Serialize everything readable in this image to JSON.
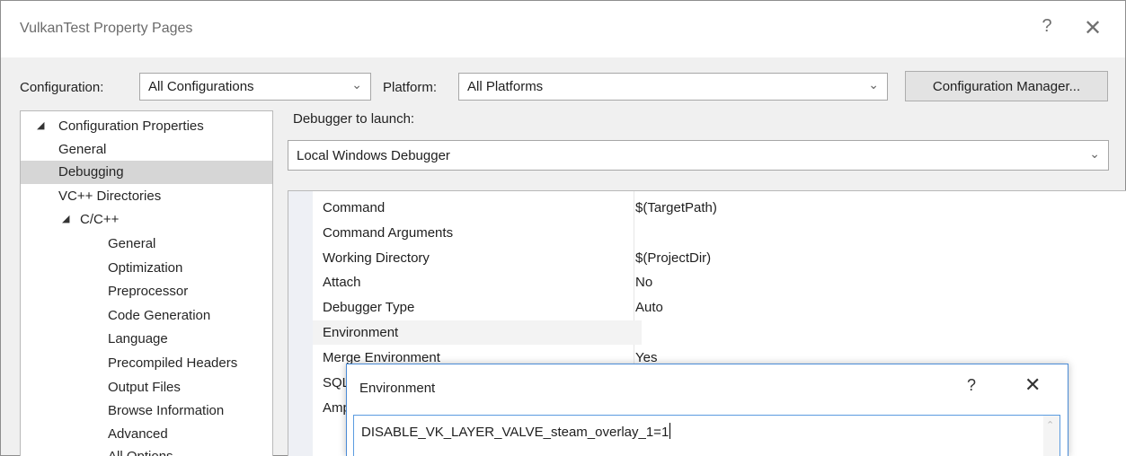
{
  "window": {
    "title": "VulkanTest Property Pages",
    "help_glyph": "?",
    "close_glyph": "✕"
  },
  "toolbar": {
    "configuration_label": "Configuration:",
    "configuration_value": "All Configurations",
    "platform_label": "Platform:",
    "platform_value": "All Platforms",
    "config_manager_label": "Configuration Manager..."
  },
  "tree": {
    "items": [
      {
        "label": "Configuration Properties",
        "expander": "◢"
      },
      {
        "label": "General"
      },
      {
        "label": "Debugging"
      },
      {
        "label": "VC++ Directories"
      },
      {
        "label": "C/C++",
        "expander": "◢"
      },
      {
        "label": "General"
      },
      {
        "label": "Optimization"
      },
      {
        "label": "Preprocessor"
      },
      {
        "label": "Code Generation"
      },
      {
        "label": "Language"
      },
      {
        "label": "Precompiled Headers"
      },
      {
        "label": "Output Files"
      },
      {
        "label": "Browse Information"
      },
      {
        "label": "Advanced"
      },
      {
        "label": "All Options"
      }
    ]
  },
  "debugger": {
    "label": "Debugger to launch:",
    "value": "Local Windows Debugger"
  },
  "properties": {
    "rows": [
      {
        "name": "Command",
        "value": "$(TargetPath)"
      },
      {
        "name": "Command Arguments",
        "value": ""
      },
      {
        "name": "Working Directory",
        "value": "$(ProjectDir)"
      },
      {
        "name": "Attach",
        "value": "No"
      },
      {
        "name": "Debugger Type",
        "value": "Auto"
      },
      {
        "name": "Environment",
        "value": ""
      },
      {
        "name": "Merge Environment",
        "value": "Yes"
      },
      {
        "name": "SQL Debugging",
        "value": ""
      },
      {
        "name": "Amp Default Accelerator",
        "value": ""
      }
    ]
  },
  "env_dialog": {
    "title": "Environment",
    "help_glyph": "?",
    "close_glyph": "✕",
    "text": "DISABLE_VK_LAYER_VALVE_steam_overlay_1=1"
  }
}
